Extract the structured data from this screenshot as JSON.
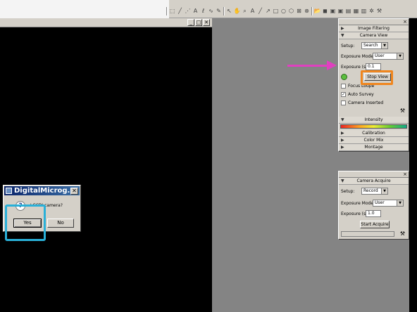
{
  "dialog": {
    "title": "DigitalMicrog...",
    "close_label": "✕",
    "question_icon": "?",
    "message": "' CCD' camera?",
    "yes_label": "Yes",
    "no_label": "No"
  },
  "image_window": {
    "min": "_",
    "max": "□",
    "close": "✕"
  },
  "camera_palette": {
    "close": "×",
    "image_filtering": "Image Filtering",
    "camera_view": "Camera View",
    "setup_label": "Setup:",
    "setup_value": "Search",
    "exposure_mode_label": "Exposure Mode:",
    "exposure_mode_value": "User",
    "exposure_label": "Exposure (s)",
    "exposure_value": "0.1",
    "stop_view": "Stop View",
    "focus_loupe": "Focus Loupe",
    "auto_survey": "Auto Survey",
    "camera_inserted": "Camera Inserted",
    "intensity": "Intensity",
    "calibration": "Calibration",
    "color_mix": "Color Mix",
    "montage": "Montage"
  },
  "acquire_palette": {
    "close": "×",
    "title": "Camera Acquire",
    "setup_label": "Setup:",
    "setup_value": "Record",
    "exposure_mode_label": "Exposure Mode:",
    "exposure_mode_value": "User",
    "exposure_label": "Exposure (s)",
    "exposure_value": "1.0",
    "start_acquire": "Start Acquire"
  },
  "colors": {
    "highlight_blue": "#2ab0d8",
    "highlight_orange": "#f0861e",
    "arrow": "#e040c0"
  }
}
